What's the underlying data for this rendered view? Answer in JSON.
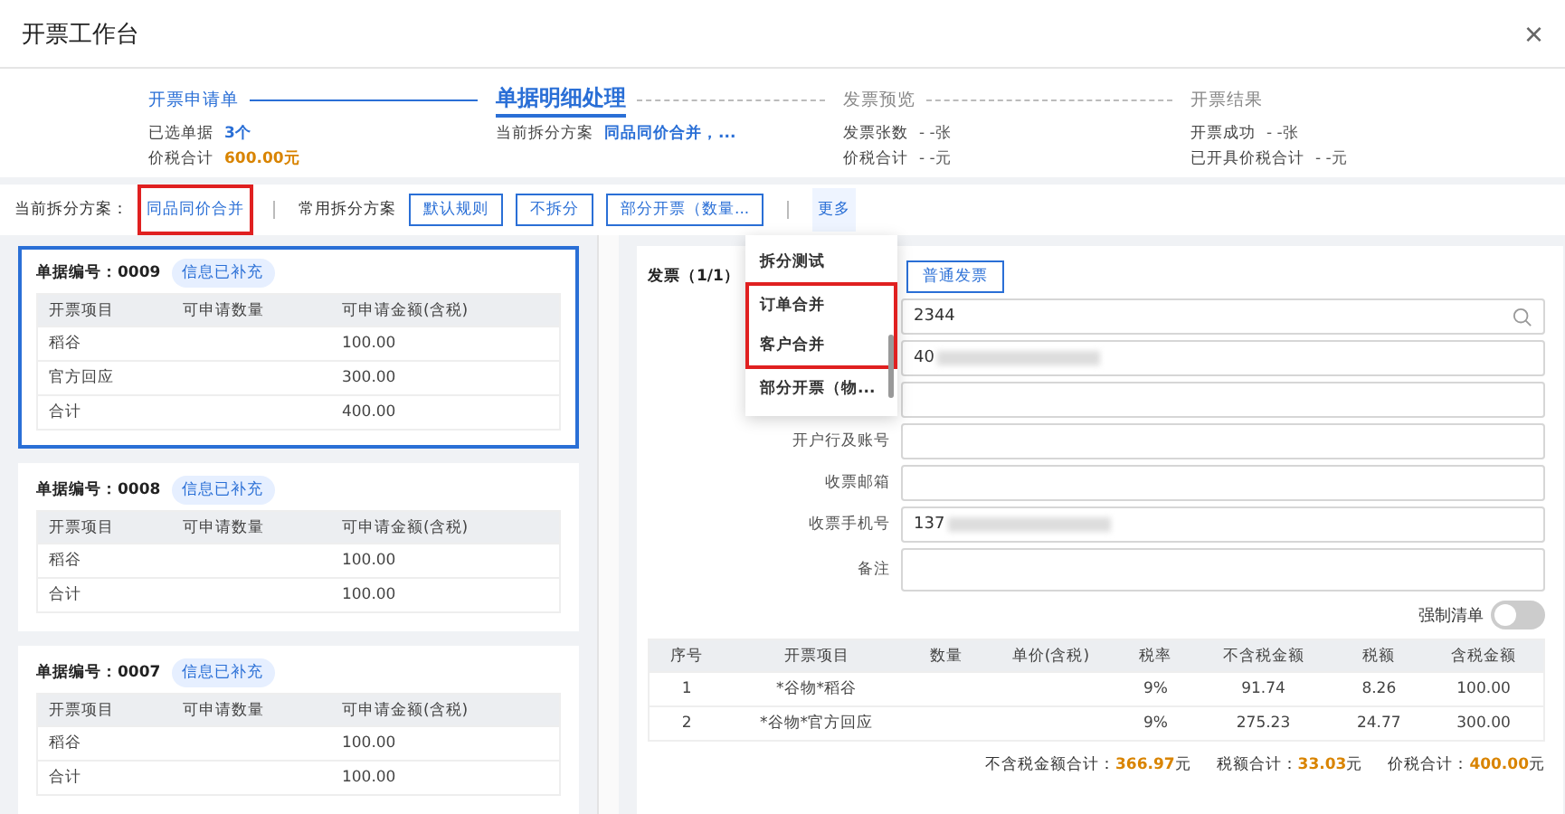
{
  "window": {
    "title": "开票工作台",
    "close": "×"
  },
  "steps": [
    {
      "label": "开票申请单",
      "selected": false,
      "completed": true,
      "details": [
        {
          "label": "已选单据",
          "value": "3个",
          "kind": "link"
        },
        {
          "label": "价税合计",
          "value": "600.00元",
          "kind": "amount"
        }
      ]
    },
    {
      "label": "单据明细处理",
      "selected": true,
      "completed": true,
      "details": [
        {
          "label": "当前拆分方案",
          "value": "同品同价合并，...",
          "kind": "link"
        }
      ]
    },
    {
      "label": "发票预览",
      "selected": false,
      "completed": false,
      "details": [
        {
          "label": "发票张数",
          "value": "- -张",
          "kind": "plain"
        },
        {
          "label": "价税合计",
          "value": "- -元",
          "kind": "plain"
        }
      ]
    },
    {
      "label": "开票结果",
      "selected": false,
      "completed": false,
      "details": [
        {
          "label": "开票成功",
          "value": "- -张",
          "kind": "plain"
        },
        {
          "label": "已开具价税合计",
          "value": "- -元",
          "kind": "plain"
        }
      ]
    }
  ],
  "toolbar": {
    "current_label": "当前拆分方案：",
    "current_plan": {
      "label": "同品同价合并",
      "highlighted": true
    },
    "common_label": "常用拆分方案",
    "buttons": [
      "默认规则",
      "不拆分",
      "部分开票（数量..."
    ],
    "more": {
      "label": "更多",
      "expanded": true
    }
  },
  "dropdown": [
    {
      "label": "拆分测试",
      "highlighted": false
    },
    {
      "label": "订单合并",
      "highlighted": true
    },
    {
      "label": "客户合并",
      "highlighted": true
    },
    {
      "label": "部分开票（物...",
      "highlighted": false
    }
  ],
  "documents": [
    {
      "title": "单据编号：0009",
      "tag": "信息已补充",
      "selected": true,
      "columns": [
        "开票项目",
        "可申请数量",
        "可申请金额(含税)"
      ],
      "rows": [
        [
          "稻谷",
          null,
          "100.00"
        ],
        [
          "官方回应",
          null,
          "300.00"
        ],
        [
          "合计",
          null,
          "400.00"
        ]
      ]
    },
    {
      "title": "单据编号：0008",
      "tag": "信息已补充",
      "selected": false,
      "columns": [
        "开票项目",
        "可申请数量",
        "可申请金额(含税)"
      ],
      "rows": [
        [
          "稻谷",
          null,
          "100.00"
        ],
        [
          "合计",
          null,
          "100.00"
        ]
      ]
    },
    {
      "title": "单据编号：0007",
      "tag": "信息已补充",
      "selected": false,
      "columns": [
        "开票项目",
        "可申请数量",
        "可申请金额(含税)"
      ],
      "rows": [
        [
          "稻谷",
          null,
          "100.00"
        ],
        [
          "合计",
          null,
          "100.00"
        ]
      ]
    }
  ],
  "invoice": {
    "title": "发票（1/1）",
    "type_button": "普通发票",
    "fields": [
      {
        "value": "2344",
        "kind": "search",
        "redacted": false
      },
      {
        "value": "40",
        "kind": "text",
        "redacted": true
      },
      {
        "kind": "text",
        "redacted": false
      },
      {
        "label": "开户行及账号",
        "kind": "text",
        "redacted": false
      },
      {
        "label": "收票邮箱",
        "kind": "text",
        "redacted": false
      },
      {
        "label": "收票手机号",
        "value": "137",
        "kind": "text",
        "redacted": true
      },
      {
        "label": "备注",
        "kind": "textarea",
        "redacted": false
      }
    ],
    "force_list": {
      "label": "强制清单",
      "on": false
    },
    "columns": [
      "序号",
      "开票项目",
      "数量",
      "单价(含税)",
      "税率",
      "不含税金额",
      "税额",
      "含税金额"
    ],
    "rows": [
      [
        "1",
        "*谷物*稻谷",
        null,
        null,
        "9%",
        "91.74",
        "8.26",
        "100.00"
      ],
      [
        "2",
        "*谷物*官方回应",
        null,
        null,
        "9%",
        "275.23",
        "24.77",
        "300.00"
      ]
    ],
    "totals": [
      {
        "label": "不含税金额合计：",
        "amount": "366.97",
        "unit": "元"
      },
      {
        "label": "税额合计：",
        "amount": "33.03",
        "unit": "元"
      },
      {
        "label": "价税合计：",
        "amount": "400.00",
        "unit": "元"
      }
    ]
  }
}
